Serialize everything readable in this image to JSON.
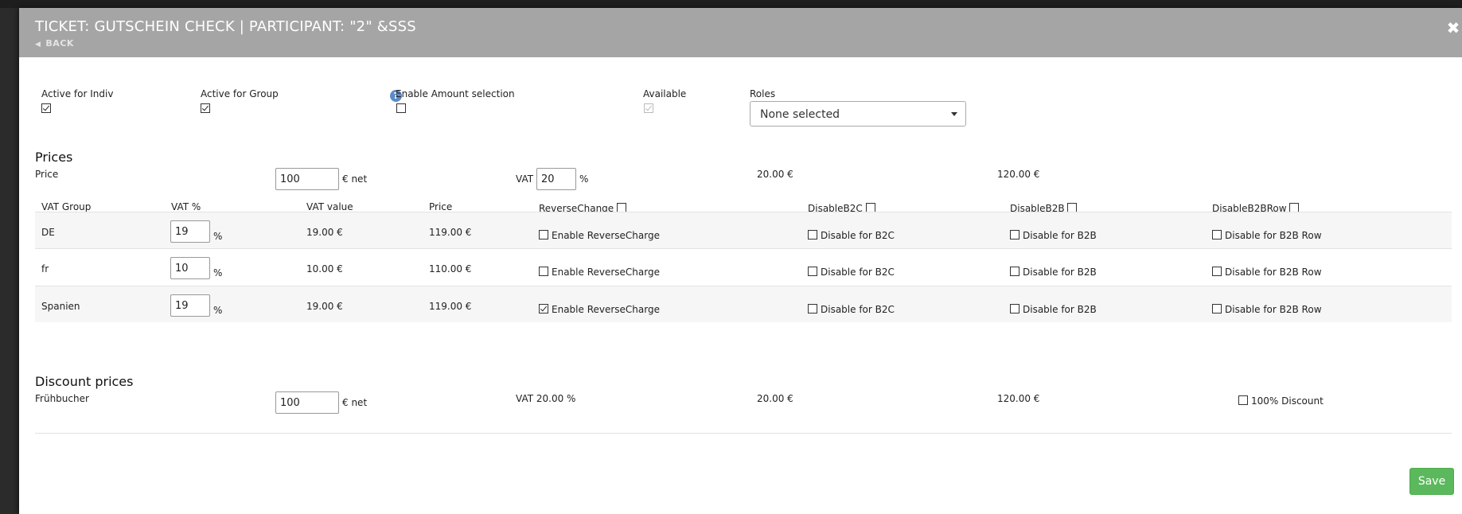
{
  "modal": {
    "title": "TICKET: GUTSCHEIN CHECK | PARTICIPANT: \"2\" &SSS",
    "back_label": "BACK",
    "close_icon": "close-icon"
  },
  "options": {
    "active_indiv_label": "Active for Indiv",
    "active_indiv_checked": true,
    "active_group_label": "Active for Group",
    "active_group_checked": true,
    "help_icon": "?",
    "enable_amount_label": "Enable Amount selection",
    "enable_amount_checked": false,
    "available_label": "Available",
    "available_checked": true,
    "roles_label": "Roles",
    "roles_value": "None selected"
  },
  "prices": {
    "heading": "Prices",
    "price_label": "Price",
    "price_value": "100",
    "price_unit": "€ net",
    "vat_label": "VAT",
    "vat_value": "20",
    "vat_unit": "%",
    "vat_amount": "20.00 €",
    "gross": "120.00 €"
  },
  "vat_table": {
    "headers": {
      "group": "VAT Group",
      "percent": "VAT %",
      "value": "VAT value",
      "price": "Price",
      "reverse": "ReverseChange",
      "b2c": "DisableB2C",
      "b2b": "DisableB2B",
      "b2brow": "DisableB2BRow"
    },
    "percent_unit": "%",
    "rows": [
      {
        "group": "DE",
        "percent": "19",
        "value": "19.00 €",
        "price": "119.00 €",
        "reverse_label": "Enable ReverseCharge",
        "reverse_checked": false,
        "b2c_label": "Disable for B2C",
        "b2b_label": "Disable for B2B",
        "b2brow_label": "Disable for B2B Row"
      },
      {
        "group": "fr",
        "percent": "10",
        "value": "10.00 €",
        "price": "110.00 €",
        "reverse_label": "Enable ReverseCharge",
        "reverse_checked": false,
        "b2c_label": "Disable for B2C",
        "b2b_label": "Disable for B2B",
        "b2brow_label": "Disable for B2B Row"
      },
      {
        "group": "Spanien",
        "percent": "19",
        "value": "19.00 €",
        "price": "119.00 €",
        "reverse_label": "Enable ReverseCharge",
        "reverse_checked": true,
        "b2c_label": "Disable for B2C",
        "b2b_label": "Disable for B2B",
        "b2brow_label": "Disable for B2B Row"
      }
    ]
  },
  "discount": {
    "heading": "Discount prices",
    "label": "Frühbucher",
    "value": "100",
    "unit": "€ net",
    "vat_text": "VAT 20.00 %",
    "vat_amount": "20.00 €",
    "gross": "120.00 €",
    "full_discount_label": "100% Discount",
    "full_discount_checked": false
  },
  "save_label": "Save"
}
